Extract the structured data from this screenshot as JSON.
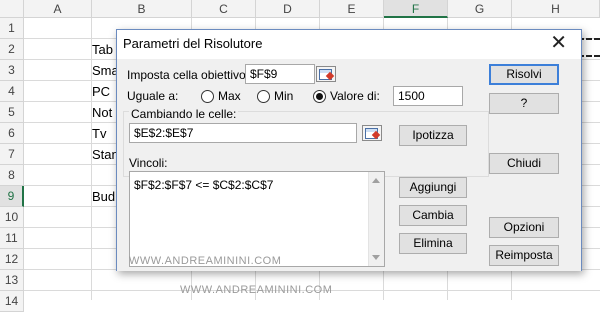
{
  "sheet": {
    "columns": [
      "A",
      "B",
      "C",
      "D",
      "E",
      "F",
      "G",
      "H"
    ],
    "rows": [
      "1",
      "2",
      "3",
      "4",
      "5",
      "6",
      "7",
      "8",
      "9",
      "10",
      "11",
      "12",
      "13",
      "14"
    ],
    "cells_b": [
      "Tab",
      "Sma",
      "PC",
      "Not",
      "Tv",
      "Stan",
      "",
      "Bud"
    ],
    "selected_column": "F",
    "selected_row": "9"
  },
  "dialog": {
    "title": "Parametri del Risolutore",
    "close_glyph": "✕",
    "objective_label": "Imposta cella obiettivo",
    "objective_value": "$F$9",
    "equal_to_label": "Uguale a:",
    "radio_max": "Max",
    "radio_min": "Min",
    "radio_value": "Valore di:",
    "value_of": "1500",
    "changing_cells_label": "Cambiando le celle:",
    "changing_cells_value": "$E$2:$E$7",
    "constraints_label": "Vincoli:",
    "constraints": [
      "$F$2:$F$7 <= $C$2:$C$7"
    ],
    "buttons": {
      "solve": "Risolvi",
      "help": "?",
      "guess": "Ipotizza",
      "close": "Chiudi",
      "add": "Aggiungi",
      "change": "Cambia",
      "delete": "Elimina",
      "options": "Opzioni",
      "reset": "Reimposta"
    }
  },
  "watermark": "WWW.ANDREAMININI.COM",
  "icons": {
    "ref_button": "range-selector-icon",
    "close": "close-icon"
  }
}
